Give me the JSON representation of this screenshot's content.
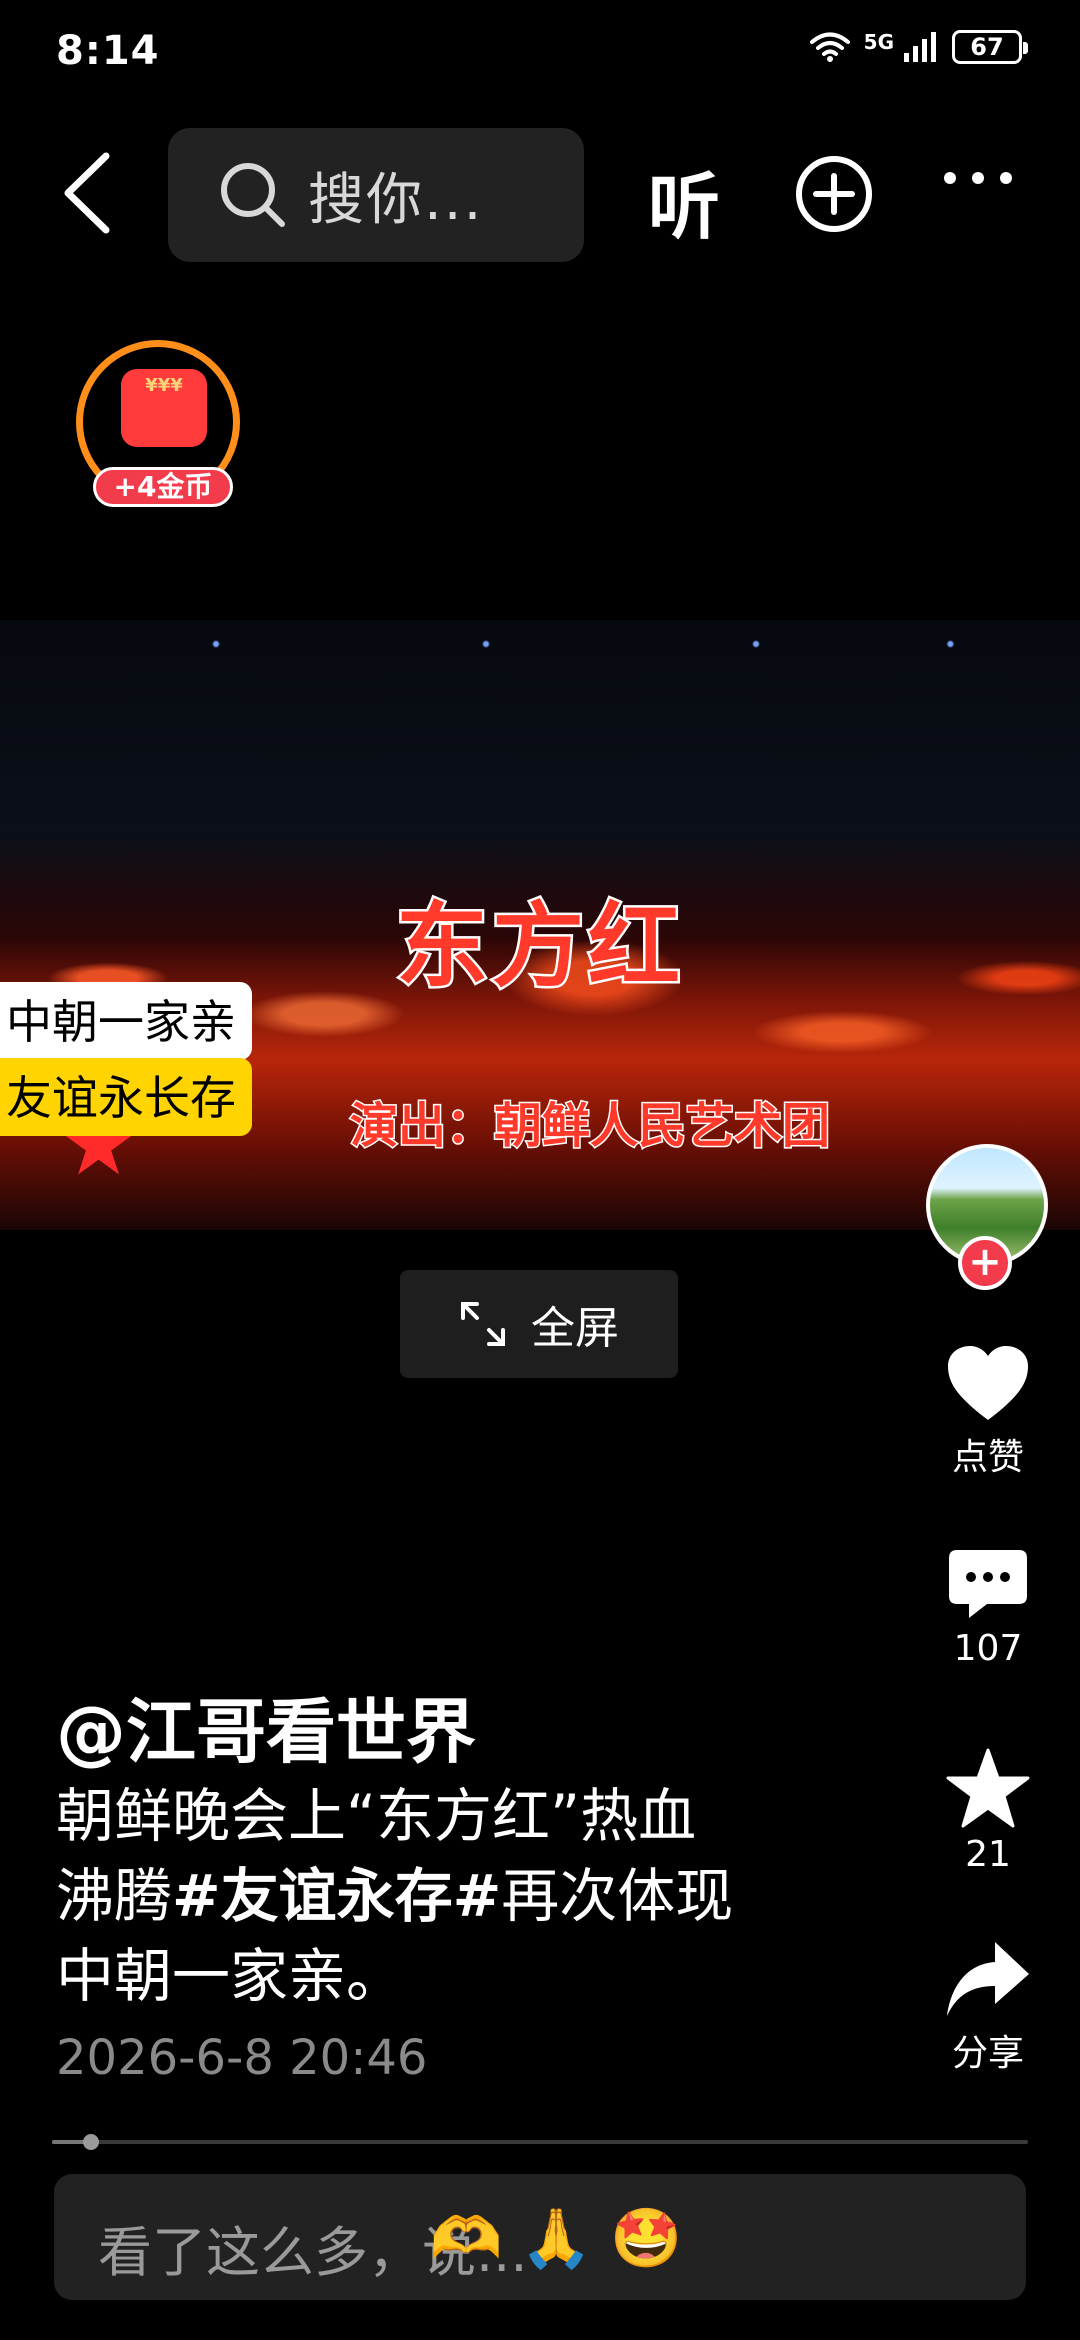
{
  "status_bar": {
    "time": "8:14",
    "network": "5G",
    "battery": "67"
  },
  "top_bar": {
    "search_placeholder": "搜你...",
    "listen_label": "听"
  },
  "coin_badge": {
    "label": "+4金币"
  },
  "video": {
    "title_overlay": "东方红",
    "subtitle_overlay": "演出：朝鲜人民艺术团",
    "tag_1": "中朝一家亲",
    "tag_2": "友谊永长存"
  },
  "fullscreen": {
    "label": "全屏"
  },
  "actions": {
    "like_label": "点赞",
    "comment_count": "107",
    "favorite_count": "21",
    "share_label": "分享"
  },
  "post": {
    "author": "@江哥看世界",
    "desc_1": "朝鲜晚会上“东方红”热血",
    "desc_2a": "沸腾",
    "hashtag": "#友谊永存#",
    "desc_2b": "再次体现",
    "desc_3": "中朝一家亲。",
    "timestamp": "2026-6-8 20:46"
  },
  "player": {
    "progress": 0.04
  },
  "comment_bar": {
    "placeholder": "看了这么多，说...",
    "emojis": [
      "🫶",
      "🙏",
      "🤩"
    ]
  },
  "colors": {
    "accent_red": "#f23b4b",
    "coin_orange": "#ff8f1a",
    "tag_yellow": "#ffd400"
  }
}
